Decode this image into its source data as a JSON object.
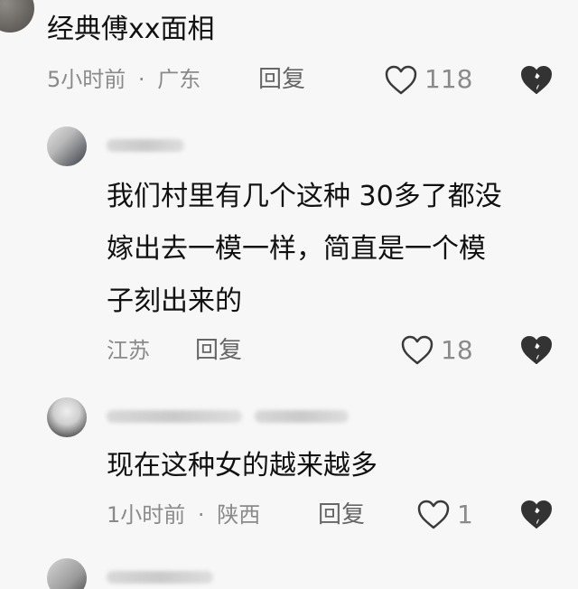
{
  "comments": [
    {
      "text": "经典傅xx面相",
      "time": "5小时前",
      "location": "广东",
      "reply_label": "回复",
      "likes": "118"
    },
    {
      "lines": [
        "我们村里有几个这种 30多了都没",
        "嫁出去一模一样，简直是一个模",
        "子刻出来的"
      ],
      "location": "江苏",
      "reply_label": "回复",
      "likes": "18"
    },
    {
      "text": "现在这种女的越来越多",
      "time": "1小时前",
      "location": "陕西",
      "reply_label": "回复",
      "likes": "1"
    }
  ],
  "separator": "·",
  "colors": {
    "background": "#f7f7f7",
    "text": "#111111",
    "meta": "#8a8a8a",
    "icon_stroke": "#3a3a3a"
  },
  "icons": {
    "like": "heart-outline-icon",
    "dislike": "broken-heart-icon"
  }
}
